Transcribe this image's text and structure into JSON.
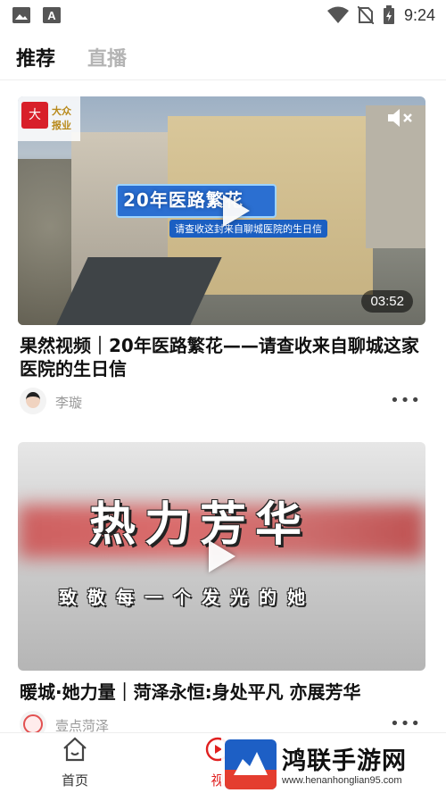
{
  "status_bar": {
    "time": "9:24",
    "icons": [
      "image-icon",
      "app-a-icon",
      "wifi-icon",
      "no-sim-icon",
      "battery-charging-icon"
    ]
  },
  "tabs": [
    {
      "label": "推荐",
      "active": true
    },
    {
      "label": "直播",
      "active": false
    }
  ],
  "feed": [
    {
      "thumbnail": {
        "banner_title": "20年医路繁花",
        "banner_sub": "请查收这封来自聊城医院的生日信",
        "logo_text": "大众报业",
        "duration": "03:52"
      },
      "title": "果然视频｜20年医路繁花——请查收来自聊城这家医院的生日信",
      "author": "李璇"
    },
    {
      "thumbnail": {
        "overlay_big": "热力芳华",
        "overlay_small": "致敬每一个发光的她"
      },
      "title": "暖城·她力量｜菏泽永恒:身处平凡 亦展芳华",
      "author": "壹点菏泽"
    }
  ],
  "bottom_nav": [
    {
      "label": "首页",
      "icon": "home-icon"
    },
    {
      "label": "视",
      "icon": "video-icon"
    }
  ],
  "watermark": {
    "title": "鸿联手游网",
    "url": "www.henanhonglian95.com"
  },
  "colors": {
    "accent": "#e02020",
    "inactive_tab": "#b4b4b4",
    "author_text": "#9a9a9a"
  }
}
